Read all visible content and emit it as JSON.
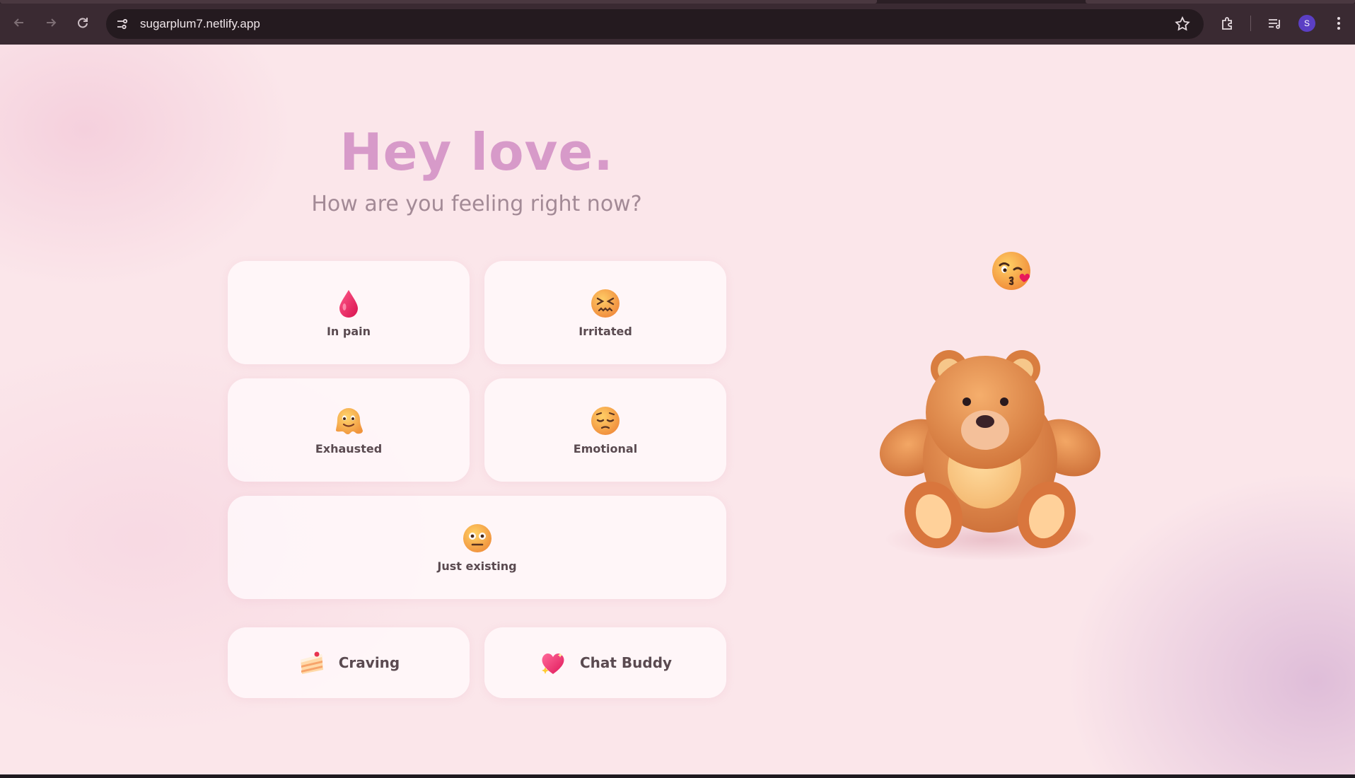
{
  "browser": {
    "url": "sugarplum7.netlify.app",
    "profile_initial": "S",
    "icons": [
      "back-icon",
      "forward-icon",
      "reload-icon",
      "site-info-icon",
      "bookmark-star-icon",
      "extensions-icon",
      "media-controls-icon",
      "more-menu-icon"
    ]
  },
  "page": {
    "title": "Hey love.",
    "subtitle": "How are you feeling right now?",
    "moods": [
      {
        "label": "In pain",
        "icon": "blood-drop-icon"
      },
      {
        "label": "Irritated",
        "icon": "confounded-face-icon"
      },
      {
        "label": "Exhausted",
        "icon": "melting-face-icon"
      },
      {
        "label": "Emotional",
        "icon": "pensive-face-icon"
      },
      {
        "label": "Just existing",
        "icon": "flat-mouth-face-icon"
      }
    ],
    "actions": [
      {
        "label": "Craving",
        "icon": "cake-slice-icon"
      },
      {
        "label": "Chat Buddy",
        "icon": "sparkling-heart-icon"
      }
    ],
    "mascot": "teddy-bear-icon",
    "mascot_badge": "kissing-face-icon"
  },
  "colors": {
    "title": "#d79ac9",
    "subtitle": "#a38a96",
    "background": "#fbe6ea",
    "card": "#fff8fa"
  }
}
